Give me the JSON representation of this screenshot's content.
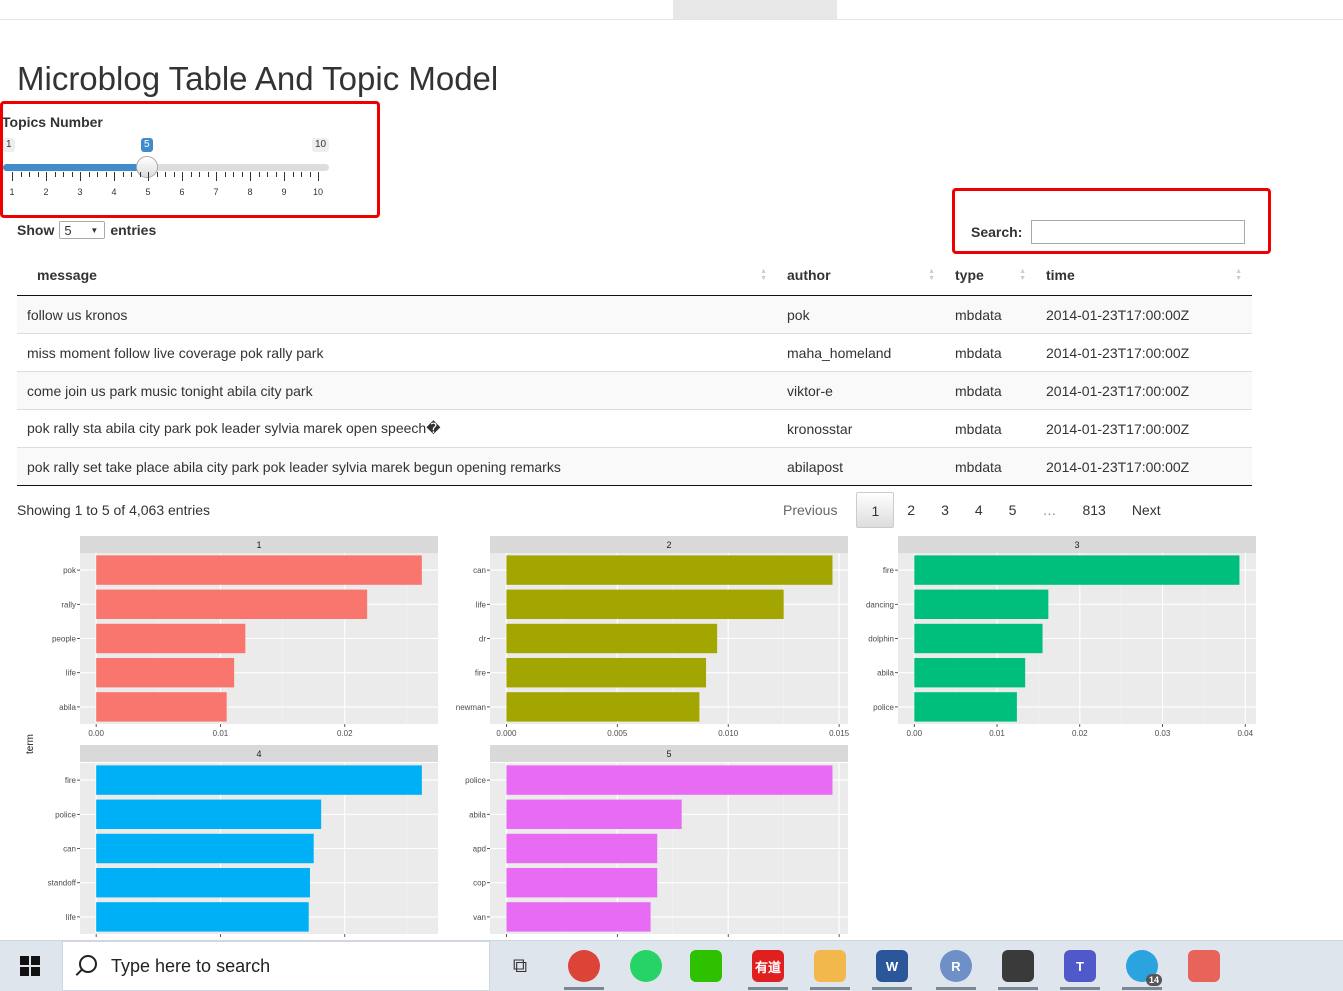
{
  "page": {
    "title": "Microblog Table And Topic Model"
  },
  "slider": {
    "label": "Topics Number",
    "min": 1,
    "max": 10,
    "value": 5,
    "ticks": [
      "1",
      "2",
      "3",
      "4",
      "5",
      "6",
      "7",
      "8",
      "9",
      "10"
    ]
  },
  "table_controls": {
    "show_label": "Show",
    "entries_label": "entries",
    "page_length": "5",
    "search_label": "Search:",
    "search_value": ""
  },
  "table": {
    "columns": [
      "message",
      "author",
      "type",
      "time"
    ],
    "rows": [
      [
        "follow us kronos",
        "pok",
        "mbdata",
        "2014-01-23T17:00:00Z"
      ],
      [
        "miss moment follow live coverage pok rally park",
        "maha_homeland",
        "mbdata",
        "2014-01-23T17:00:00Z"
      ],
      [
        "come join us park music tonight abila city park",
        "viktor-e",
        "mbdata",
        "2014-01-23T17:00:00Z"
      ],
      [
        "pok rally sta abila city park pok leader sylvia marek open speech�",
        "kronosstar",
        "mbdata",
        "2014-01-23T17:00:00Z"
      ],
      [
        "pok rally set take place abila city park pok leader sylvia marek begun opening remarks",
        "abilapost",
        "mbdata",
        "2014-01-23T17:00:00Z"
      ]
    ]
  },
  "table_info": "Showing 1 to 5 of 4,063 entries",
  "pagination": {
    "previous": "Previous",
    "pages": [
      "1",
      "2",
      "3",
      "4",
      "5",
      "…",
      "813"
    ],
    "next": "Next",
    "current": "1"
  },
  "chart_data": {
    "type": "bar",
    "ylabel": "term",
    "panels": [
      {
        "title": "1",
        "color": "#F8766D",
        "terms": [
          "pok",
          "rally",
          "people",
          "life",
          "abila"
        ],
        "values": [
          0.0262,
          0.0218,
          0.012,
          0.0111,
          0.0105
        ],
        "xlim": [
          -0.0013,
          0.0275
        ],
        "ticks": [
          0,
          0.01,
          0.02
        ],
        "tick_labels": [
          "0.00",
          "0.01",
          "0.02"
        ]
      },
      {
        "title": "2",
        "color": "#A3A500",
        "terms": [
          "can",
          "life",
          "dr",
          "fire",
          "newman"
        ],
        "values": [
          0.0147,
          0.0125,
          0.0095,
          0.009,
          0.0087
        ],
        "xlim": [
          -0.00074,
          0.0154
        ],
        "ticks": [
          0,
          0.005,
          0.01,
          0.015
        ],
        "tick_labels": [
          "0.000",
          "0.005",
          "0.010",
          "0.015"
        ]
      },
      {
        "title": "3",
        "color": "#00BF7D",
        "terms": [
          "fire",
          "dancing",
          "dolphin",
          "abila",
          "police"
        ],
        "values": [
          0.0393,
          0.0162,
          0.0155,
          0.0134,
          0.0124
        ],
        "xlim": [
          -0.00197,
          0.0413
        ],
        "ticks": [
          0,
          0.01,
          0.02,
          0.03,
          0.04
        ],
        "tick_labels": [
          "0.00",
          "0.01",
          "0.02",
          "0.03",
          "0.04"
        ]
      },
      {
        "title": "4",
        "color": "#00B0F6",
        "terms": [
          "fire",
          "police",
          "can",
          "standoff",
          "life"
        ],
        "values": [
          0.0262,
          0.0181,
          0.0175,
          0.0172,
          0.0171
        ],
        "xlim": [
          -0.0013,
          0.0275
        ],
        "ticks": [
          0,
          0.01,
          0.02
        ],
        "tick_labels": [
          "",
          "",
          ""
        ]
      },
      {
        "title": "5",
        "color": "#E76BF3",
        "terms": [
          "police",
          "abila",
          "apd",
          "cop",
          "van"
        ],
        "values": [
          0.0147,
          0.0079,
          0.0068,
          0.0068,
          0.0065
        ],
        "xlim": [
          -0.00074,
          0.0154
        ],
        "ticks": [
          0,
          0.005,
          0.01,
          0.015
        ],
        "tick_labels": [
          "",
          "",
          "",
          ""
        ]
      }
    ]
  },
  "taskbar": {
    "search_placeholder": "Type here to search",
    "apps": [
      {
        "name": "task-view",
        "icon": "task-view-icon",
        "color": "#333333"
      },
      {
        "name": "chrome",
        "icon": "chrome-icon",
        "color": "#DB4437"
      },
      {
        "name": "whatsapp",
        "icon": "whatsapp-icon",
        "color": "#25D366"
      },
      {
        "name": "wechat",
        "icon": "wechat-icon",
        "color": "#2DC100"
      },
      {
        "name": "youdao",
        "icon": "youdao-icon",
        "color": "#E02020",
        "text": "有道"
      },
      {
        "name": "file-explorer",
        "icon": "folder-icon",
        "color": "#F2B84B"
      },
      {
        "name": "word",
        "icon": "word-icon",
        "color": "#2B579A",
        "text": "W"
      },
      {
        "name": "r",
        "icon": "r-icon",
        "color": "#6F8FC7",
        "text": "R"
      },
      {
        "name": "terminal",
        "icon": "terminal-icon",
        "color": "#3A3A3A"
      },
      {
        "name": "teams",
        "icon": "teams-icon",
        "color": "#5059C9",
        "text": "T"
      },
      {
        "name": "telegram",
        "icon": "telegram-icon",
        "color": "#2AA3DF",
        "badge": "14"
      },
      {
        "name": "snipping",
        "icon": "snipping-icon",
        "color": "#E8635A"
      }
    ]
  }
}
